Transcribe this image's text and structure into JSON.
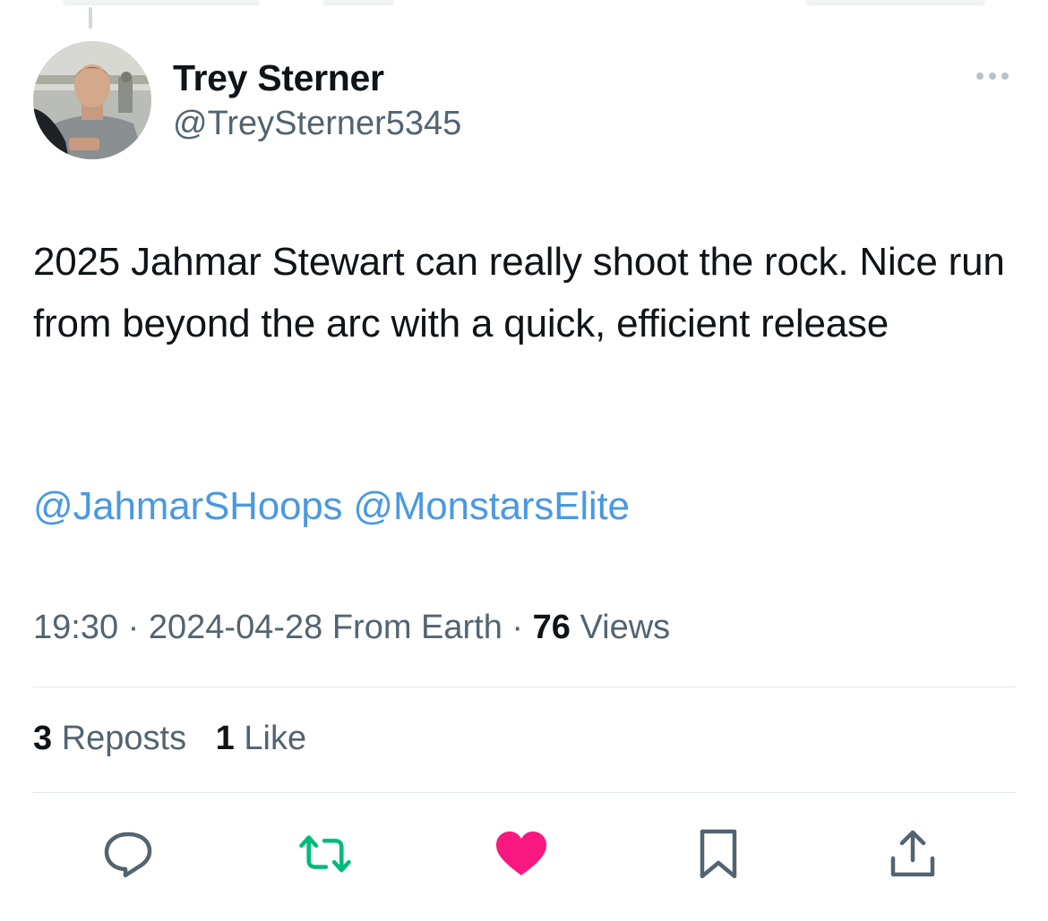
{
  "author": {
    "display_name": "Trey Sterner",
    "handle": "@TreySterner5345"
  },
  "tweet": {
    "text": "2025 Jahmar Stewart can really shoot the rock. Nice run from beyond the arc with a quick, efficient release",
    "mentions": [
      "@JahmarSHoops",
      "@MonstarsElite"
    ]
  },
  "meta": {
    "time": "19:30",
    "sep1": " · ",
    "date": "2024-04-28",
    "source": "From Earth",
    "sep2": " · ",
    "views_count": "76",
    "views_label": "Views"
  },
  "stats": {
    "reposts_count": "3",
    "reposts_label": "Reposts",
    "likes_count": "1",
    "likes_label": "Like"
  },
  "icons": {
    "reply": "reply-icon",
    "retweet": "retweet-icon",
    "like": "heart-icon",
    "bookmark": "bookmark-icon",
    "share": "share-icon",
    "more": "more-icon"
  },
  "colors": {
    "link": "#4a99e0",
    "retweet_active": "#00ba7c",
    "like_active": "#f91880",
    "secondary_text": "#536471"
  }
}
